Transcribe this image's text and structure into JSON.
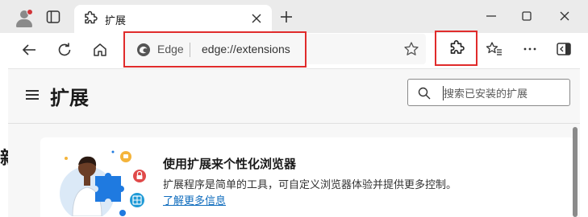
{
  "browser": {
    "tab": {
      "title": "扩展",
      "icon": "puzzle-icon"
    },
    "window_controls": [
      "minimize-icon",
      "maximize-icon",
      "close-icon"
    ],
    "address_bar": {
      "site_label": "Edge",
      "url": "edge://extensions"
    },
    "toolbar_icons": [
      "back-icon",
      "refresh-icon",
      "home-icon",
      "favorite-star-icon",
      "extensions-icon",
      "favorites-icon",
      "more-icon",
      "sidebar-icon"
    ]
  },
  "page": {
    "title": "扩展",
    "clipped_heading_glyph": "新",
    "search": {
      "placeholder": "搜索已安装的扩展",
      "value": ""
    },
    "promo": {
      "title": "使用扩展来个性化浏览器",
      "description": "扩展程序是简单的工具，可自定义浏览器体验并提供更多控制。",
      "link": "了解更多信息"
    }
  },
  "colors": {
    "highlight_box": "#e02b2b",
    "link": "#0f6cbd",
    "tab_strip": "#ebebeb",
    "page_bg": "#f7f7f7"
  }
}
